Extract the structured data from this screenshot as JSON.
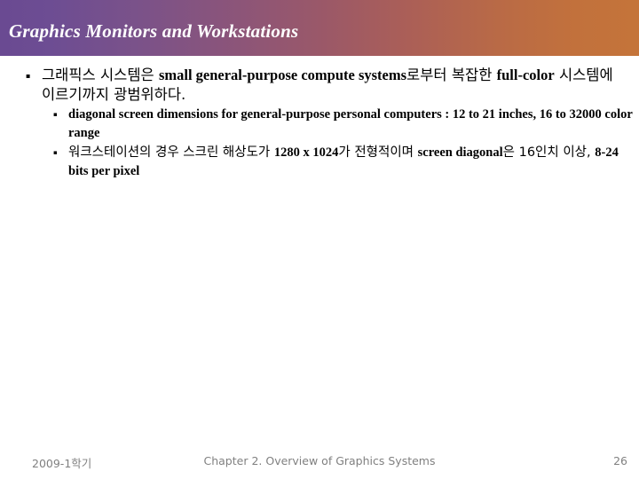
{
  "slide": {
    "title": "Graphics Monitors and Workstations",
    "header_gradient_start": "#6a4a92",
    "header_gradient_mid": "#9a5869",
    "header_gradient_end": "#c4743a",
    "bullet_marker": "▪",
    "bullets": [
      {
        "level": 1,
        "segments": [
          {
            "lang": "ko",
            "text": "그래픽스 시스템은 "
          },
          {
            "lang": "en",
            "text": "small general-purpose compute systems"
          },
          {
            "lang": "ko",
            "text": "로부터 복잡한 "
          },
          {
            "lang": "en",
            "text": "full-color"
          },
          {
            "lang": "ko",
            "text": " 시스템에 이르기까지 광범위하다."
          }
        ]
      },
      {
        "level": 2,
        "segments": [
          {
            "lang": "en",
            "text": "diagonal screen dimensions for general-purpose personal computers : 12 to 21 inches, 16 to 32000 color range"
          }
        ]
      },
      {
        "level": 2,
        "segments": [
          {
            "lang": "ko",
            "text": "워크스테이션의 경우 스크린 해상도가 "
          },
          {
            "lang": "en",
            "text": "1280 x 1024"
          },
          {
            "lang": "ko",
            "text": "가 전형적이며 "
          },
          {
            "lang": "en",
            "text": "screen diagonal"
          },
          {
            "lang": "ko",
            "text": "은 16인치 이상, "
          },
          {
            "lang": "en",
            "text": "8-24 bits per pixel"
          }
        ]
      }
    ]
  },
  "footer": {
    "semester": "2009-1학기",
    "chapter": "Chapter 2. Overview of Graphics Systems",
    "page_number": "26"
  }
}
